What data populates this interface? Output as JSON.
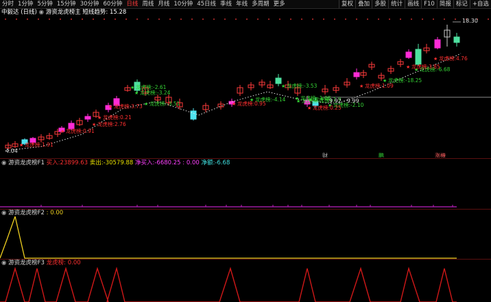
{
  "toolbar": {
    "periods": [
      "分时",
      "1分钟",
      "5分钟",
      "15分钟",
      "30分钟",
      "60分钟",
      "日线",
      "周线",
      "月线",
      "10分钟",
      "45日线",
      "季线",
      "年线",
      "多周期",
      "更多"
    ],
    "active_period": "日线",
    "tools": [
      "复权",
      "叠加",
      "多股",
      "统计",
      "画线",
      "F10",
      "简报",
      "标记",
      "+自选"
    ]
  },
  "main": {
    "stock_name": "中毅达",
    "period_label": "(日线)",
    "indicator_title": "游资龙虎榜主",
    "trend_label": "短线趋势:",
    "trend_value": "15.28",
    "high_label": "18.30",
    "low_label": "4.04",
    "range_label": "9.92 - 9.99",
    "bottom_markers": [
      "财",
      "鹏",
      "涨機"
    ],
    "annotations_green": [
      {
        "text": "龙虎榜:-2.61"
      },
      {
        "text": "龙虎榜:-3.24"
      },
      {
        "text": "龙虎榜:-3.51"
      },
      {
        "text": "龙虎榜:-3.53"
      },
      {
        "text": "龙虎榜:-4.14"
      },
      {
        "text": "龙虎榜:-1.53"
      },
      {
        "text": "龙虎榜:-1.08"
      },
      {
        "text": "龙虎榜:-1.9"
      },
      {
        "text": "龙虎榜:-2.10"
      },
      {
        "text": "龙虎榜:-18.25"
      },
      {
        "text": "龙虎榜:-6.68"
      }
    ],
    "annotations_red": [
      {
        "text": "龙虎榜:1.91"
      },
      {
        "text": "龙虎榜:0.91"
      },
      {
        "text": "龙虎榜:2.76"
      },
      {
        "text": "龙虎榜:0.21"
      },
      {
        "text": "龙虎榜:3.73"
      },
      {
        "text": "龙虎榜:0.95"
      },
      {
        "text": "龙虎榜:0.25"
      },
      {
        "text": "龙虎榜:1.09"
      },
      {
        "text": "龙虎榜:3.85"
      },
      {
        "text": "龙虎榜:4.76"
      }
    ]
  },
  "pane1": {
    "title": "游资龙虎榜F1",
    "buy_label": "买入:",
    "buy_value": "23899.63",
    "sell_label": "卖出:",
    "sell_value": "-30579.88",
    "netbuy_label": "净买入:",
    "netbuy_value": "-6680.25 : 0.00",
    "netamt_label": "净额:",
    "netamt_value": "-6.68"
  },
  "pane2": {
    "title": "游资龙虎榜F2",
    "value": ": 0.00"
  },
  "pane3": {
    "title": "游资龙虎榜F3",
    "label": "龙虎榜:",
    "value": "0.00"
  },
  "colors": {
    "up": "#ff3b3b",
    "down": "#4ee0a0",
    "cyan": "#4fe3f0",
    "magenta": "#ff2bd6",
    "yellow": "#f0d020",
    "green_text": "#35d235",
    "red_text": "#ff3030"
  }
}
